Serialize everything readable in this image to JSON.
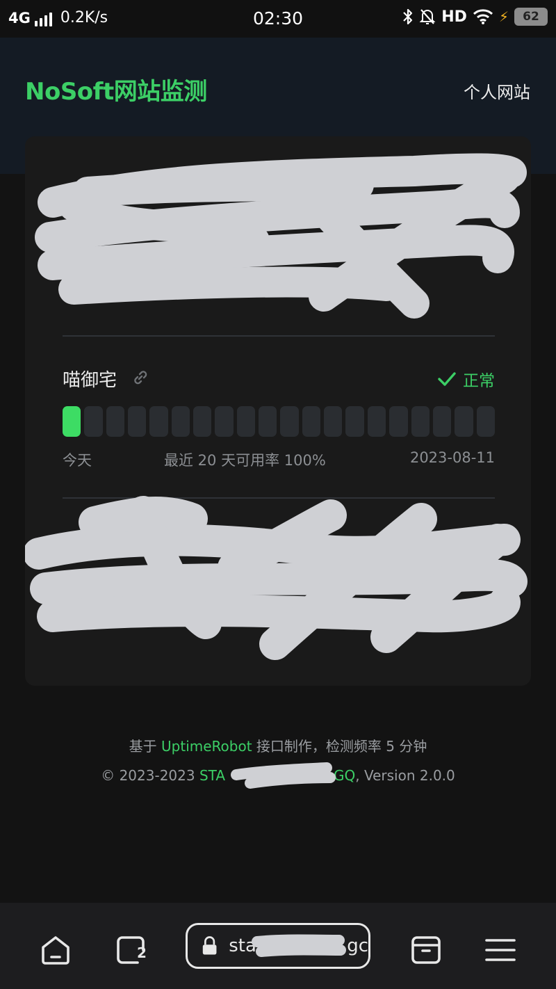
{
  "status_bar": {
    "network": "4G",
    "speed": "0.2K/s",
    "time": "02:30",
    "hd": "HD",
    "battery": "62"
  },
  "header": {
    "title": "NoSoft网站监测",
    "personal_link": "个人网站"
  },
  "monitors": [
    {
      "name": "喵御宅",
      "status": "正常",
      "bars": [
        "up",
        "none",
        "none",
        "none",
        "none",
        "none",
        "none",
        "none",
        "none",
        "none",
        "none",
        "none",
        "none",
        "none",
        "none",
        "none",
        "none",
        "none",
        "none",
        "none"
      ],
      "today_label": "今天",
      "summary": "最近 20 天可用率 100%",
      "date": "2023-08-11"
    }
  ],
  "footer": {
    "line1_prefix": "基于 ",
    "line1_link": "UptimeRobot",
    "line1_suffix": " 接口制作，检测频率 5 分钟",
    "line2_prefix": "© 2023-2023 ",
    "line2_link_start": "STA",
    "line2_link_end": "GQ",
    "line2_suffix": ", Version 2.0.0"
  },
  "browser": {
    "url": "sta",
    "url_end": "gc",
    "tab_count": "2"
  },
  "colors": {
    "accent": "#3ccf66",
    "bar_up": "#3ddc64",
    "bar_empty": "#2a2d31",
    "card_bg": "#1a1a1a",
    "header_bg": "#141b24"
  }
}
